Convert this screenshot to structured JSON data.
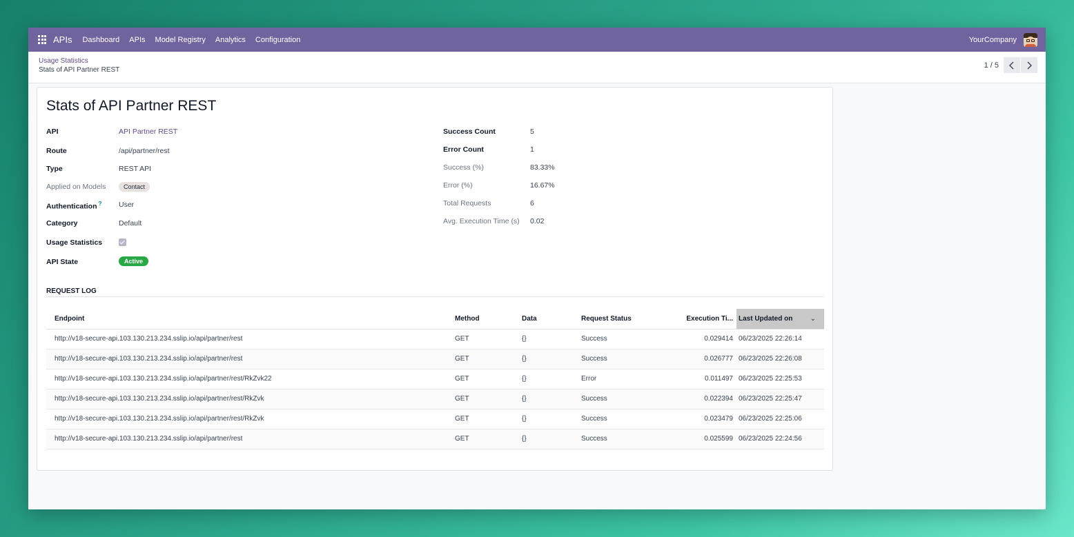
{
  "navbar": {
    "app_name": "APIs",
    "menu": [
      "Dashboard",
      "APIs",
      "Model Registry",
      "Analytics",
      "Configuration"
    ],
    "company": "YourCompany",
    "apps_icon": "grid-icon",
    "avatar": "user-avatar",
    "background": "#71639e"
  },
  "breadcrumb": {
    "parent": "Usage Statistics",
    "current": "Stats of API Partner REST"
  },
  "pager": {
    "value": "1 / 5",
    "prev_icon": "chevron-left-icon",
    "next_icon": "chevron-right-icon"
  },
  "record": {
    "title": "Stats of API Partner REST",
    "left_fields": {
      "api": {
        "label": "API",
        "value": "API Partner REST"
      },
      "route": {
        "label": "Route",
        "value": "/api/partner/rest"
      },
      "type": {
        "label": "Type",
        "value": "REST API"
      },
      "models": {
        "label": "Applied on Models",
        "tag": "Contact"
      },
      "authentication": {
        "label": "Authentication",
        "help": "?",
        "value": "User"
      },
      "category": {
        "label": "Category",
        "value": "Default"
      },
      "usage_statistics": {
        "label": "Usage Statistics",
        "checked": true
      },
      "api_state": {
        "label": "API State",
        "value": "Active",
        "color": "#28a745"
      }
    },
    "right_fields": {
      "success_count": {
        "label": "Success Count",
        "value": "5"
      },
      "error_count": {
        "label": "Error Count",
        "value": "1"
      },
      "success_pct": {
        "label": "Success (%)",
        "value": "83.33%"
      },
      "error_pct": {
        "label": "Error (%)",
        "value": "16.67%"
      },
      "total_requests": {
        "label": "Total Requests",
        "value": "6"
      },
      "avg_exec": {
        "label": "Avg. Execution Time (s)",
        "value": "0.02"
      }
    }
  },
  "request_log": {
    "title": "REQUEST LOG",
    "columns": [
      "Endpoint",
      "Method",
      "Data",
      "Request Status",
      "Execution Ti...",
      "Last Updated on"
    ],
    "sort_icon": "chevron-down-icon",
    "rows": [
      [
        "http://v18-secure-api.103.130.213.234.sslip.io/api/partner/rest",
        "GET",
        "{}",
        "Success",
        "0.029414",
        "06/23/2025 22:26:14"
      ],
      [
        "http://v18-secure-api.103.130.213.234.sslip.io/api/partner/rest",
        "GET",
        "{}",
        "Success",
        "0.026777",
        "06/23/2025 22:26:08"
      ],
      [
        "http://v18-secure-api.103.130.213.234.sslip.io/api/partner/rest/RkZvk22",
        "GET",
        "{}",
        "Error",
        "0.011497",
        "06/23/2025 22:25:53"
      ],
      [
        "http://v18-secure-api.103.130.213.234.sslip.io/api/partner/rest/RkZvk",
        "GET",
        "{}",
        "Success",
        "0.022394",
        "06/23/2025 22:25:47"
      ],
      [
        "http://v18-secure-api.103.130.213.234.sslip.io/api/partner/rest/RkZvk",
        "GET",
        "{}",
        "Success",
        "0.023479",
        "06/23/2025 22:25:06"
      ],
      [
        "http://v18-secure-api.103.130.213.234.sslip.io/api/partner/rest",
        "GET",
        "{}",
        "Success",
        "0.025599",
        "06/23/2025 22:24:56"
      ]
    ]
  }
}
